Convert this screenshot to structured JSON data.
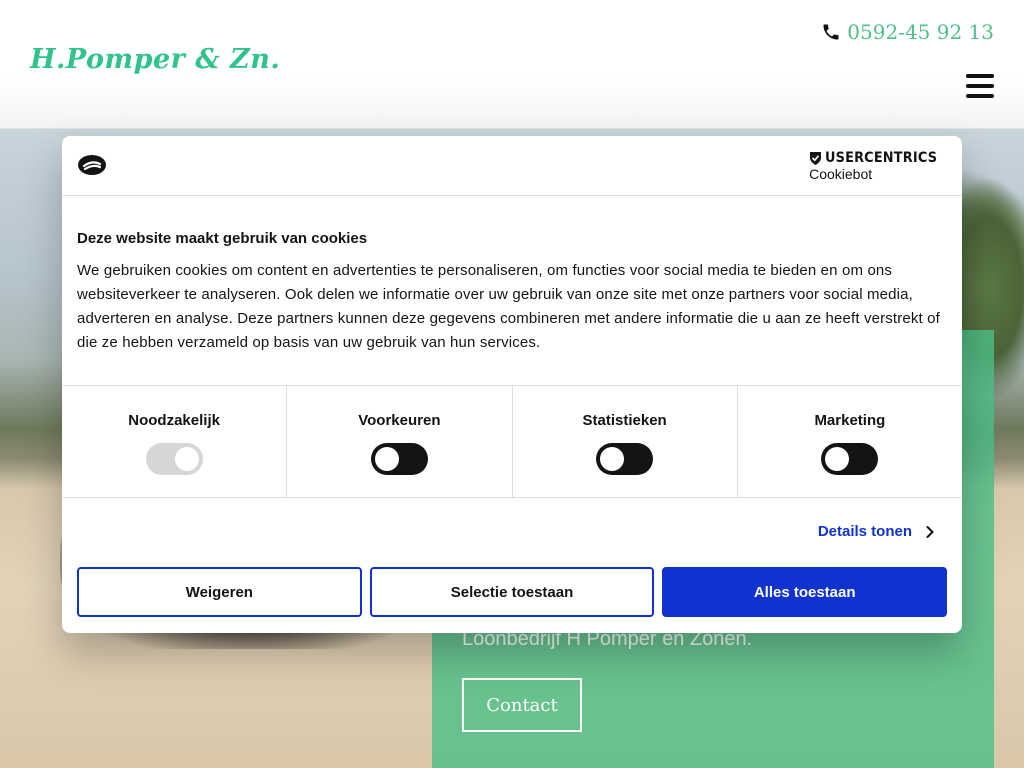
{
  "header": {
    "logo_text": "H.Pomper & Zn.",
    "phone": "0592-45 92 13",
    "phone_icon": "phone-icon",
    "menu_icon": "hamburger-menu-icon"
  },
  "hero": {
    "text": "Loonbedrijf H Pomper en Zonen.",
    "contact_label": "Contact",
    "panel_color": "#4ebf87"
  },
  "cookie_dialog": {
    "brand_name": "USERCENTRICS",
    "brand_sub": "Cookiebot",
    "title": "Deze website maakt gebruik van cookies",
    "text": "We gebruiken cookies om content en advertenties te personaliseren, om functies voor social media te bieden en om ons websiteverkeer te analyseren. Ook delen we informatie over uw gebruik van onze site met onze partners voor social media, adverteren en analyse. Deze partners kunnen deze gegevens combineren met andere informatie die u aan ze heeft verstrekt of die ze hebben verzameld op basis van uw gebruik van hun services.",
    "toggles": [
      {
        "label": "Noodzakelijk",
        "state": "on",
        "disabled": true
      },
      {
        "label": "Voorkeuren",
        "state": "off",
        "disabled": false
      },
      {
        "label": "Statistieken",
        "state": "off",
        "disabled": false
      },
      {
        "label": "Marketing",
        "state": "off",
        "disabled": false
      }
    ],
    "details_label": "Details tonen",
    "buttons": {
      "deny": "Weigeren",
      "selection": "Selectie toestaan",
      "allow_all": "Alles toestaan"
    },
    "accent_color": "#1032cf"
  }
}
